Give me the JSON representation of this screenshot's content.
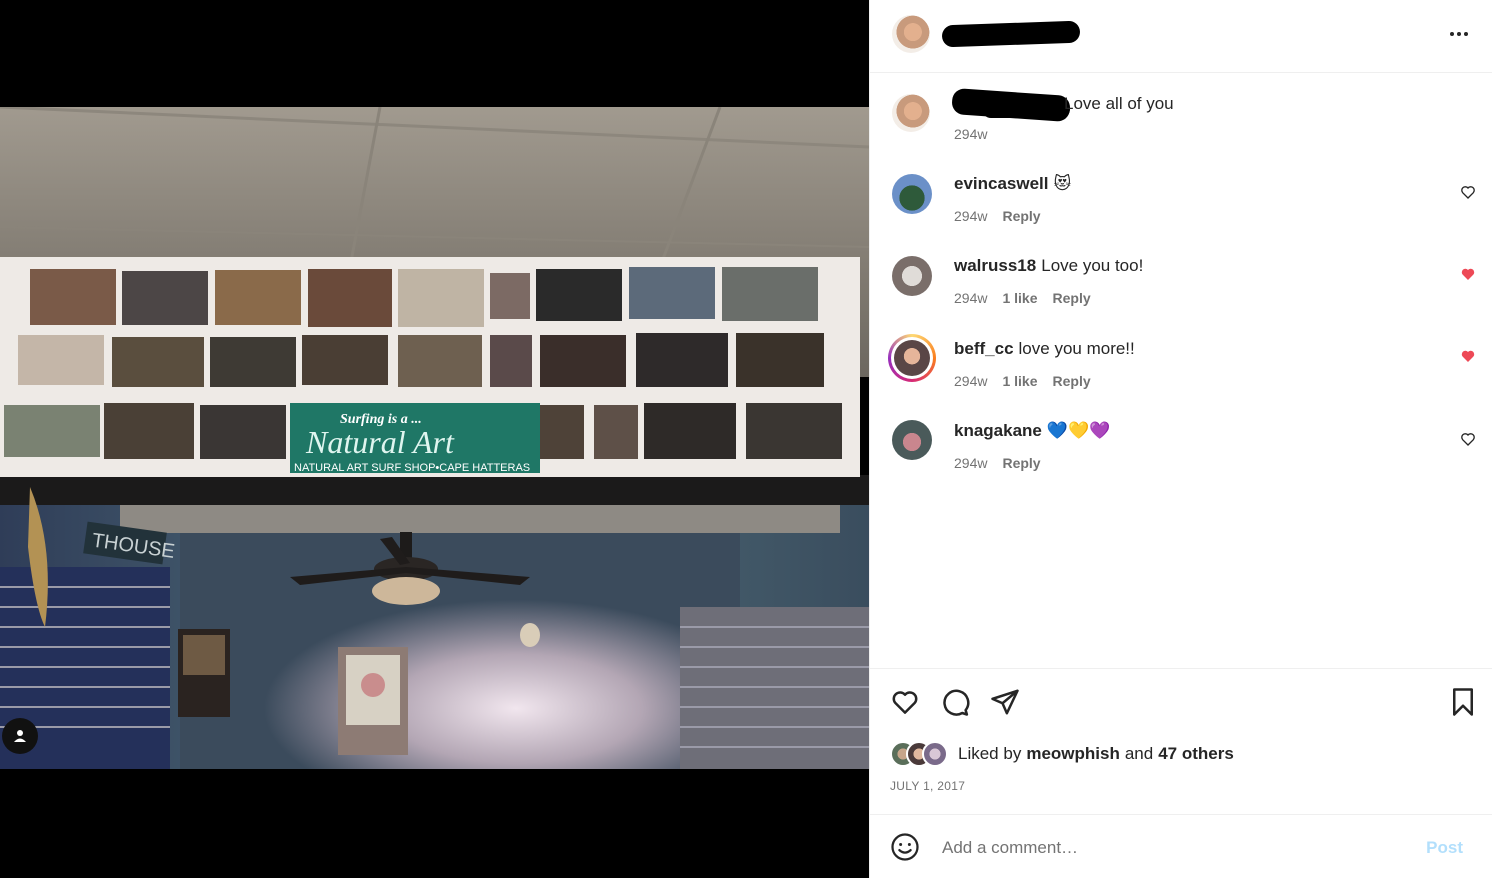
{
  "photo": {
    "sign_line1": "Surfing is a ...",
    "sign_line2": "Natural Art",
    "sign_line3": "NATURAL ART SURF SHOP•CAPE HATTERAS",
    "wall_sign": "THOUSE"
  },
  "header": {
    "more_icon": "more-horizontal-icon"
  },
  "caption": {
    "text": "Love all of you",
    "time": "294w"
  },
  "comments": [
    {
      "user": "evincaswell",
      "text": "😻",
      "time": "294w",
      "likes": "",
      "reply": "Reply",
      "liked": false
    },
    {
      "user": "walruss18",
      "text": "Love you too!",
      "time": "294w",
      "likes": "1 like",
      "reply": "Reply",
      "liked": true
    },
    {
      "user": "beff_cc",
      "text": "love you more!!",
      "time": "294w",
      "likes": "1 like",
      "reply": "Reply",
      "liked": true
    },
    {
      "user": "knagakane",
      "text": "💙💛💜",
      "time": "294w",
      "likes": "",
      "reply": "Reply",
      "liked": false
    }
  ],
  "actions": {
    "liked_prefix": "Liked by",
    "liked_user": "meowphish",
    "liked_and": "and",
    "liked_others": "47 others",
    "date": "JULY 1, 2017"
  },
  "comment_bar": {
    "placeholder": "Add a comment…",
    "post_label": "Post"
  },
  "colors": {
    "liked_heart": "#ed4956",
    "post_disabled": "#b2dffc"
  }
}
